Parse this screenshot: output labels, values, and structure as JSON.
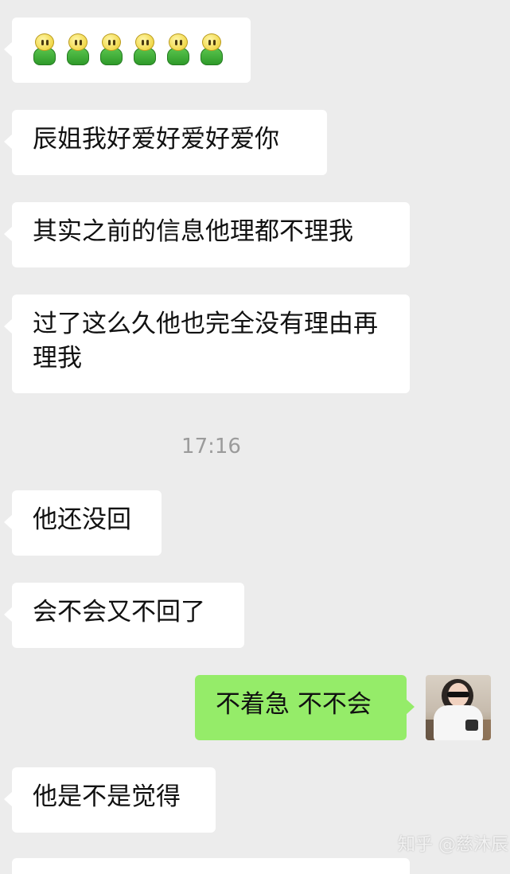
{
  "chat": {
    "emoji_message": {
      "count": 6,
      "icon": "green-figure-emoji"
    },
    "messages_before_time": [
      {
        "text": "辰姐我好爱好爱好爱你"
      },
      {
        "text": "其实之前的信息他理都不理我"
      },
      {
        "text": "过了这么久他也完全没有理由再理我"
      }
    ],
    "timestamp": "17:16",
    "messages_after_time": [
      {
        "text": "他还没回"
      },
      {
        "text": "会不会又不回了"
      }
    ],
    "outgoing_message": {
      "text": "不着急 不不会"
    },
    "after_outgoing": [
      {
        "text": "他是不是觉得"
      }
    ]
  },
  "watermark": "知乎 @慈沐辰",
  "colors": {
    "chat_background": "#ececec",
    "incoming_bubble": "#ffffff",
    "outgoing_bubble": "#95ec69",
    "timestamp": "#9b9b9b"
  }
}
